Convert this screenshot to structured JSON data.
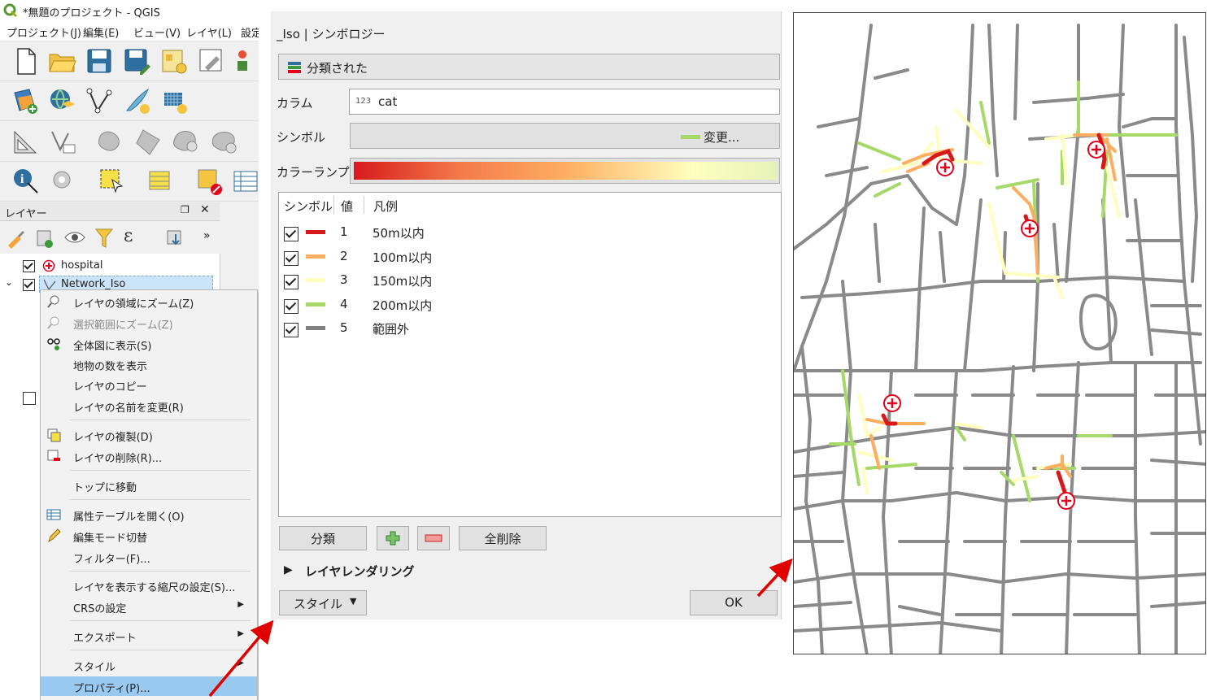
{
  "window": {
    "title": "*無題のプロジェクト - QGIS"
  },
  "menubar": [
    "プロジェクト(J)",
    "編集(E)",
    "ビュー(V)",
    "レイヤ(L)",
    "設定"
  ],
  "toolbar_icons": [
    [
      "new-project-icon",
      "open-project-icon",
      "save-project-icon",
      "save-as-icon",
      "layout-manager-icon",
      "style-manager-icon",
      "python-icon"
    ],
    [
      "add-layer-icon",
      "add-wms-icon",
      "add-vector-icon",
      "digitize-icon",
      "add-raster-icon"
    ],
    [
      "measure-icon",
      "vertex-tool-icon",
      "processing-1-icon",
      "processing-2-icon",
      "processing-3-icon",
      "processing-4-icon"
    ],
    [
      "identify-icon",
      "action-icon",
      "select-icon",
      "attribute-table-icon",
      "deselect-icon",
      "open-table-icon"
    ]
  ],
  "layers_panel": {
    "title": "レイヤー",
    "layers": [
      {
        "name": "hospital",
        "checked": true
      },
      {
        "name": "Network_Iso",
        "checked": true
      }
    ]
  },
  "context_menu": {
    "items": [
      {
        "label": "レイヤの領域にズーム(Z)",
        "icon": "zoom-layer-icon",
        "enabled": true
      },
      {
        "label": "選択範囲にズーム(Z)",
        "icon": "zoom-selection-icon",
        "enabled": false
      },
      {
        "label": "全体図に表示(S)",
        "icon": "overview-icon",
        "enabled": true
      },
      {
        "label": "地物の数を表示",
        "icon": "",
        "enabled": true
      },
      {
        "label": "レイヤのコピー",
        "icon": "",
        "enabled": true
      },
      {
        "label": "レイヤの名前を変更(R)",
        "icon": "",
        "enabled": true
      },
      {
        "label": "レイヤの複製(D)",
        "icon": "duplicate-layer-icon",
        "enabled": true
      },
      {
        "label": "レイヤの削除(R)...",
        "icon": "remove-layer-icon",
        "enabled": true
      },
      {
        "label": "トップに移動",
        "icon": "",
        "enabled": true
      },
      {
        "label": "属性テーブルを開く(O)",
        "icon": "attribute-table-icon",
        "enabled": true
      },
      {
        "label": "編集モード切替",
        "icon": "edit-pencil-icon",
        "enabled": true
      },
      {
        "label": "フィルター(F)...",
        "icon": "",
        "enabled": true
      },
      {
        "label": "レイヤを表示する縮尺の設定(S)...",
        "icon": "",
        "enabled": true
      },
      {
        "label": "CRSの設定",
        "icon": "",
        "enabled": true,
        "submenu": true
      },
      {
        "label": "エクスポート",
        "icon": "",
        "enabled": true,
        "submenu": true
      },
      {
        "label": "スタイル",
        "icon": "",
        "enabled": true,
        "submenu": true
      },
      {
        "label": "プロパティ(P)...",
        "icon": "",
        "enabled": true,
        "selected": true
      }
    ]
  },
  "symbology_dialog": {
    "title": "_Iso | シンボロジー",
    "renderer": "分類された",
    "column_label": "カラム",
    "column_type_badge": "123",
    "column_value": "cat",
    "symbol_label": "シンボル",
    "symbol_change": "変更...",
    "color_ramp_label": "カラーランプ",
    "table_headers": [
      "シンボル",
      "値",
      "凡例"
    ],
    "classes": [
      {
        "value": "1",
        "legend": "50m以内",
        "color": "#d7191c",
        "checked": true
      },
      {
        "value": "2",
        "legend": "100m以内",
        "color": "#fdae61",
        "checked": true
      },
      {
        "value": "3",
        "legend": "150m以内",
        "color": "#ffffbf",
        "checked": true
      },
      {
        "value": "4",
        "legend": "200m以内",
        "color": "#a6d96a",
        "checked": true
      },
      {
        "value": "5",
        "legend": "範囲外",
        "color": "#808080",
        "checked": true
      }
    ],
    "buttons": {
      "classify": "分類",
      "delete_all": "全削除",
      "style": "スタイル",
      "ok": "OK"
    },
    "layer_rendering": "レイヤレンダリング"
  },
  "colors": {
    "accent_red": "#e3001b",
    "selection": "#99c9ef",
    "arrow": "#e00000"
  }
}
